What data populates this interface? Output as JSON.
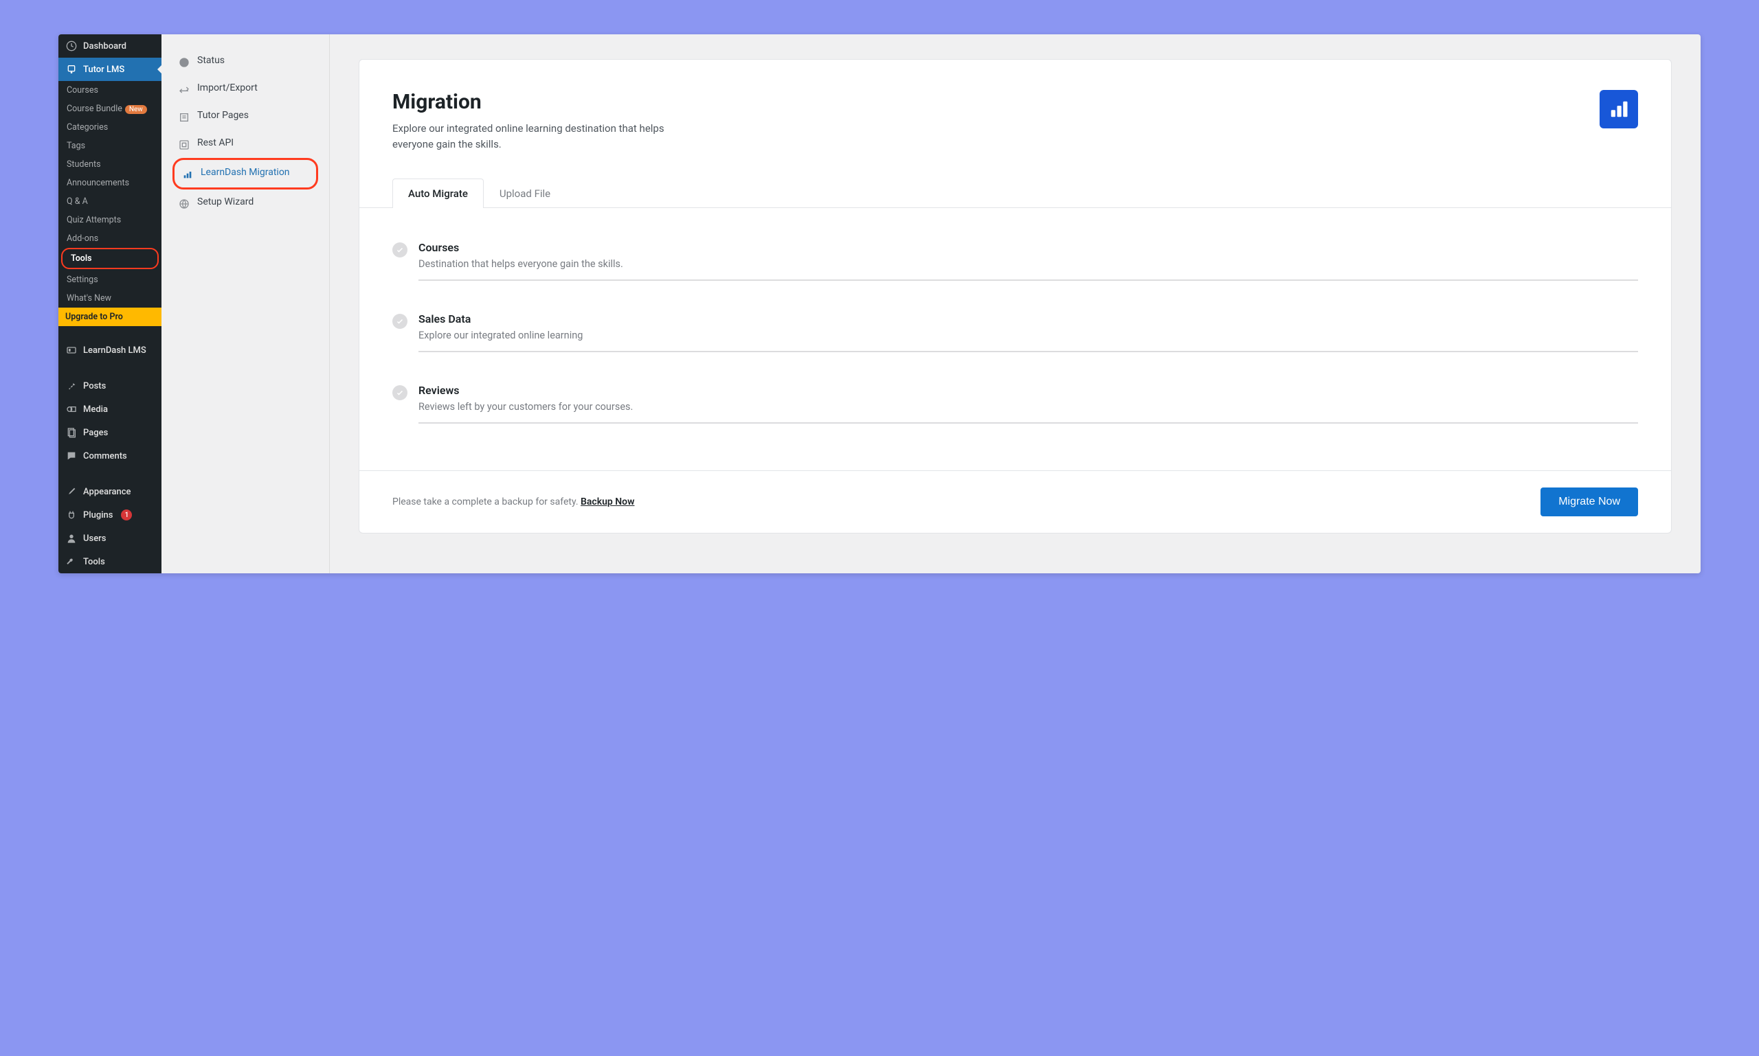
{
  "wp_sidebar": {
    "items": [
      {
        "label": "Dashboard",
        "icon": "dashboard"
      },
      {
        "label": "Tutor LMS",
        "icon": "tutor",
        "active": true
      }
    ],
    "submenu": [
      {
        "label": "Courses"
      },
      {
        "label": "Course Bundle",
        "badge": "New"
      },
      {
        "label": "Categories"
      },
      {
        "label": "Tags"
      },
      {
        "label": "Students"
      },
      {
        "label": "Announcements"
      },
      {
        "label": "Q & A"
      },
      {
        "label": "Quiz Attempts"
      },
      {
        "label": "Add-ons"
      },
      {
        "label": "Tools",
        "bold": true,
        "highlight": true
      },
      {
        "label": "Settings"
      },
      {
        "label": "What's New"
      }
    ],
    "upgrade": "Upgrade to Pro",
    "rest": [
      {
        "label": "LearnDash LMS",
        "icon": "learndash"
      },
      {
        "label": "Posts",
        "icon": "pin"
      },
      {
        "label": "Media",
        "icon": "media"
      },
      {
        "label": "Pages",
        "icon": "pages"
      },
      {
        "label": "Comments",
        "icon": "comment"
      },
      {
        "label": "Appearance",
        "icon": "brush"
      },
      {
        "label": "Plugins",
        "icon": "plug",
        "notif": "1"
      },
      {
        "label": "Users",
        "icon": "user"
      },
      {
        "label": "Tools",
        "icon": "wrench"
      }
    ]
  },
  "tools": {
    "items": [
      {
        "label": "Status",
        "icon": "pie"
      },
      {
        "label": "Import/Export",
        "icon": "arrows"
      },
      {
        "label": "Tutor Pages",
        "icon": "page"
      },
      {
        "label": "Rest API",
        "icon": "api"
      },
      {
        "label": "LearnDash Migration",
        "icon": "bars",
        "active": true
      },
      {
        "label": "Setup Wizard",
        "icon": "globe"
      }
    ]
  },
  "main": {
    "title": "Migration",
    "subtitle": "Explore our integrated online learning destination that helps everyone gain the skills.",
    "tabs": [
      {
        "label": "Auto Migrate",
        "active": true
      },
      {
        "label": "Upload File"
      }
    ],
    "items": [
      {
        "title": "Courses",
        "desc": "Destination that helps everyone gain the skills."
      },
      {
        "title": "Sales Data",
        "desc": "Explore our integrated online learning"
      },
      {
        "title": "Reviews",
        "desc": "Reviews left by your customers for your courses."
      }
    ],
    "footer_text": "Please take a complete a backup for safety. ",
    "footer_link": "Backup Now",
    "button": "Migrate Now"
  }
}
